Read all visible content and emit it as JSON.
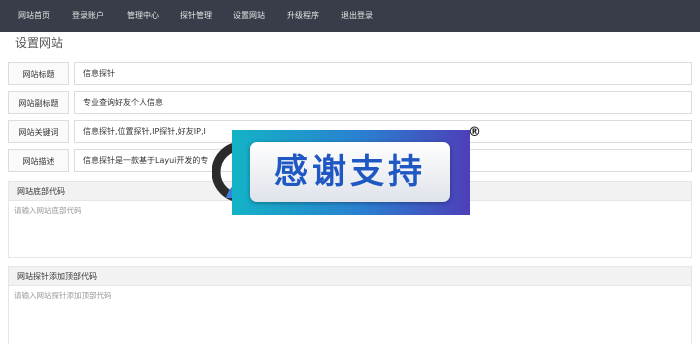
{
  "nav": {
    "items": [
      "网站首页",
      "登录账户",
      "管理中心",
      "探针管理",
      "设置网站",
      "升级程序",
      "退出登录"
    ]
  },
  "page": {
    "title": "设置网站"
  },
  "form": {
    "rows": [
      {
        "label": "网站标题",
        "value": "信息探针"
      },
      {
        "label": "网站副标题",
        "value": "专业查询好友个人信息"
      },
      {
        "label": "网站关键词",
        "value": "信息探针,位置探针,IP探针,好友IP,I"
      },
      {
        "label": "网站描述",
        "value": "信息探针是一款基于Layui开发的专"
      }
    ]
  },
  "footer_code": {
    "label": "网站底部代码",
    "placeholder": "请输入网站底部代码"
  },
  "probe_head_code": {
    "label": "网站探针添加顶部代码",
    "placeholder": "请输入网站探针添加顶部代码"
  },
  "banner": {
    "text": "感谢支持",
    "mark": "®"
  },
  "colors": {
    "nav_bg": "#393d49",
    "banner_text": "#1f57c3"
  }
}
